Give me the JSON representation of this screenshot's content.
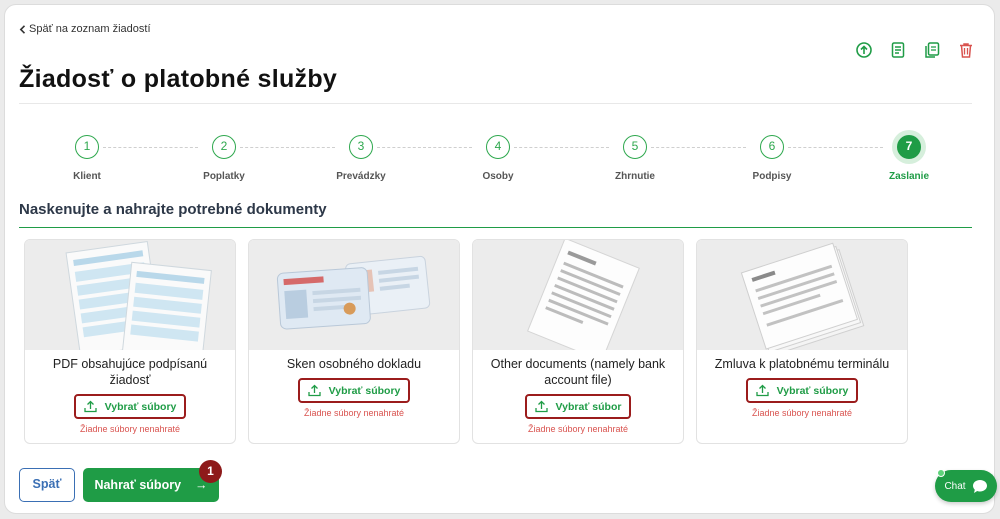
{
  "nav": {
    "back_label": "Späť na zoznam žiadostí"
  },
  "page": {
    "title": "Žiadosť o platobné služby"
  },
  "toolbar": {
    "icons": [
      "upload-circle-icon",
      "document-list-icon",
      "document-copy-icon",
      "trash-icon"
    ]
  },
  "steps": [
    {
      "num": "1",
      "label": "Klient"
    },
    {
      "num": "2",
      "label": "Poplatky"
    },
    {
      "num": "3",
      "label": "Prevádzky"
    },
    {
      "num": "4",
      "label": "Osoby"
    },
    {
      "num": "5",
      "label": "Zhrnutie"
    },
    {
      "num": "6",
      "label": "Podpisy"
    },
    {
      "num": "7",
      "label": "Zaslanie"
    }
  ],
  "active_step": 7,
  "section": {
    "title": "Naskenujte a nahrajte potrebné dokumenty"
  },
  "documents": [
    {
      "title": "PDF obsahujúce podpísanú žiadosť",
      "button": "Vybrať súbory",
      "status": "Žiadne súbory nenahraté"
    },
    {
      "title": "Sken osobného dokladu",
      "button": "Vybrať súbory",
      "status": "Žiadne súbory nenahraté"
    },
    {
      "title": "Other documents (namely bank account file)",
      "button": "Vybrať súbor",
      "status": "Žiadne súbory nenahraté"
    },
    {
      "title": "Zmluva k platobnému terminálu",
      "button": "Vybrať súbory",
      "status": "Žiadne súbory nenahraté"
    }
  ],
  "footer": {
    "back_label": "Späť",
    "upload_label": "Nahrať súbory",
    "badge": "1"
  },
  "chat": {
    "label": "Chat"
  },
  "colors": {
    "accent": "#1f9c46",
    "danger": "#d9534f",
    "highlight": "#9b1c1c",
    "link": "#3a6fb4"
  }
}
